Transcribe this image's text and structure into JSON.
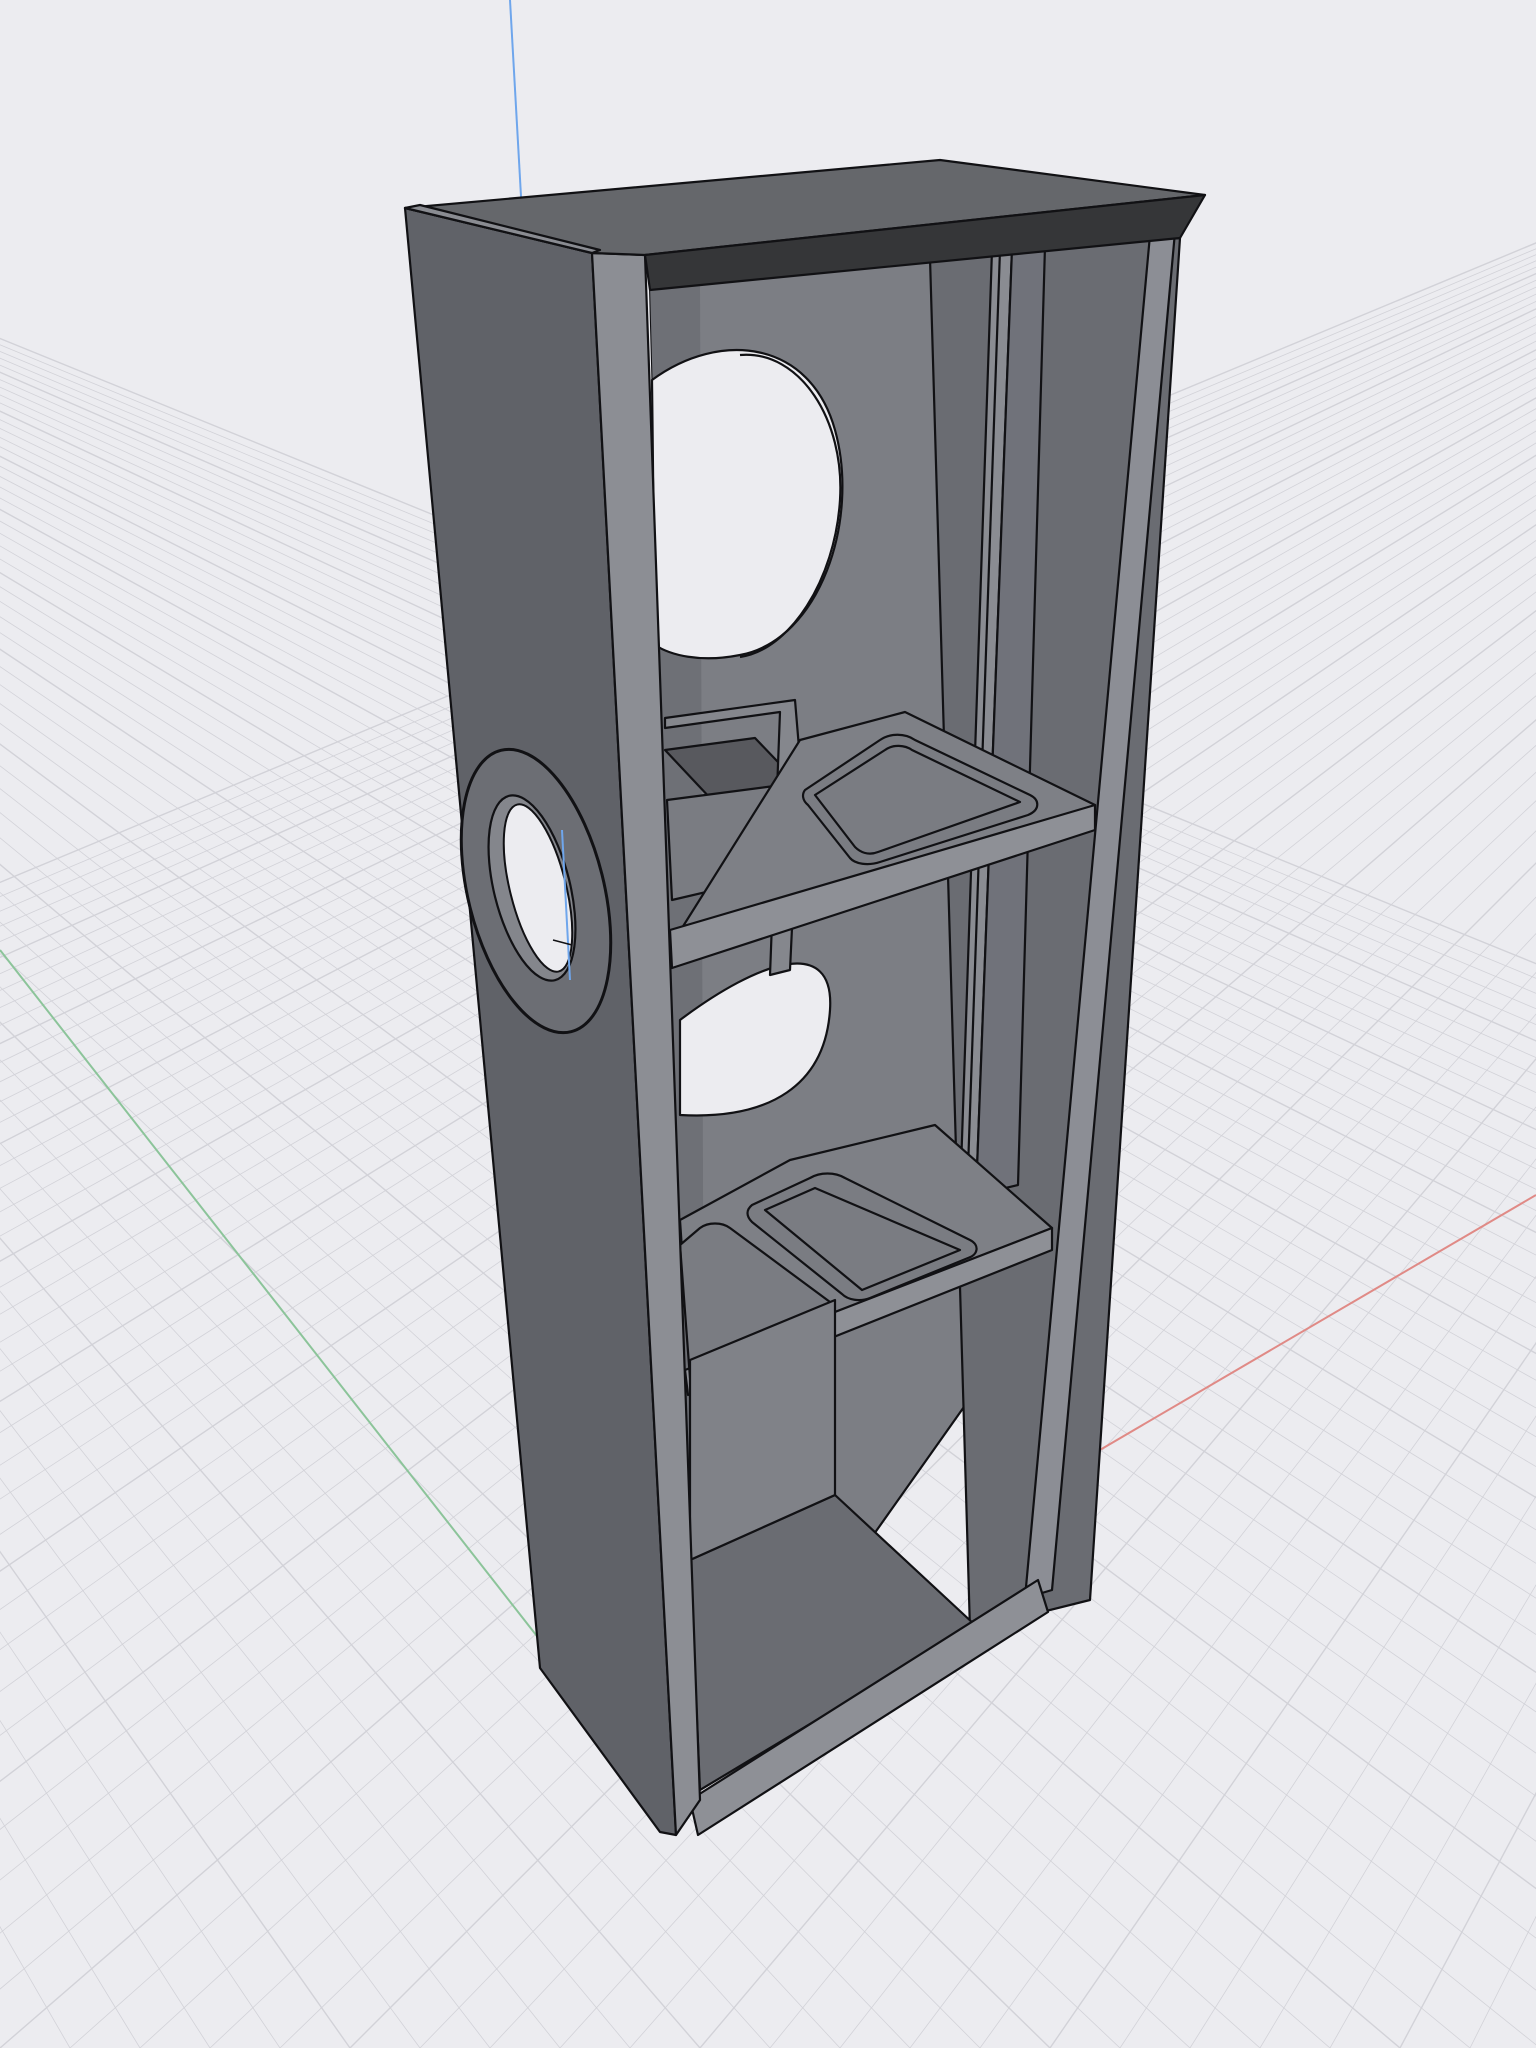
{
  "viewport": {
    "background": "#ececf0",
    "grid": true,
    "grid_color": "#d2d2d8",
    "grid_minor_color": "#e0e0e5",
    "axes": {
      "x_color": "#e08a86",
      "y_color": "#8cc49a",
      "z_color": "#6fa6ec"
    }
  },
  "model": {
    "name": "speaker-enclosure-cutaway",
    "shade_dark": "#5e6066",
    "shade_mid": "#74767c",
    "shade_light": "#8a8c92",
    "shade_top": "#646669",
    "shade_top_edge": "#353638",
    "outline": "#111114"
  }
}
